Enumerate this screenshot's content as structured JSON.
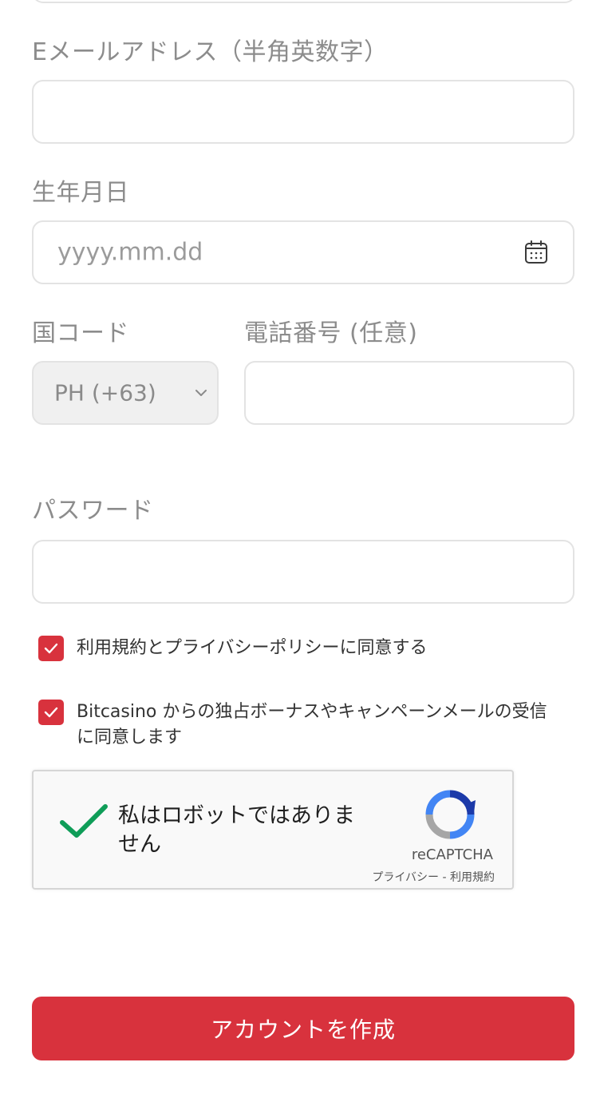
{
  "form": {
    "email_label": "Eメールアドレス（半角英数字）",
    "email_value": "",
    "birthdate_label": "生年月日",
    "birthdate_placeholder": "yyyy.mm.dd",
    "country_code_label": "国コード",
    "country_code_value": "PH (+63)",
    "phone_label": "電話番号 (任意)",
    "phone_value": "",
    "password_label": "パスワード",
    "password_value": ""
  },
  "consents": [
    {
      "label": "利用規約とプライバシーポリシーに同意する",
      "checked": true
    },
    {
      "label": "Bitcasino からの独占ボーナスやキャンペーンメールの受信に同意します",
      "checked": true
    }
  ],
  "captcha": {
    "text": "私はロボットではありません",
    "brand": "reCAPTCHA",
    "links": "プライバシー - 利用規約",
    "verified": true
  },
  "submit": {
    "label": "アカウントを作成"
  },
  "colors": {
    "accent": "#d8323d",
    "label": "#8c8c8c",
    "border": "#e3e3e3",
    "captcha_check": "#0f9d58"
  },
  "icons": [
    "calendar-icon",
    "chevron-down-icon",
    "check-icon",
    "recaptcha-logo-icon"
  ]
}
